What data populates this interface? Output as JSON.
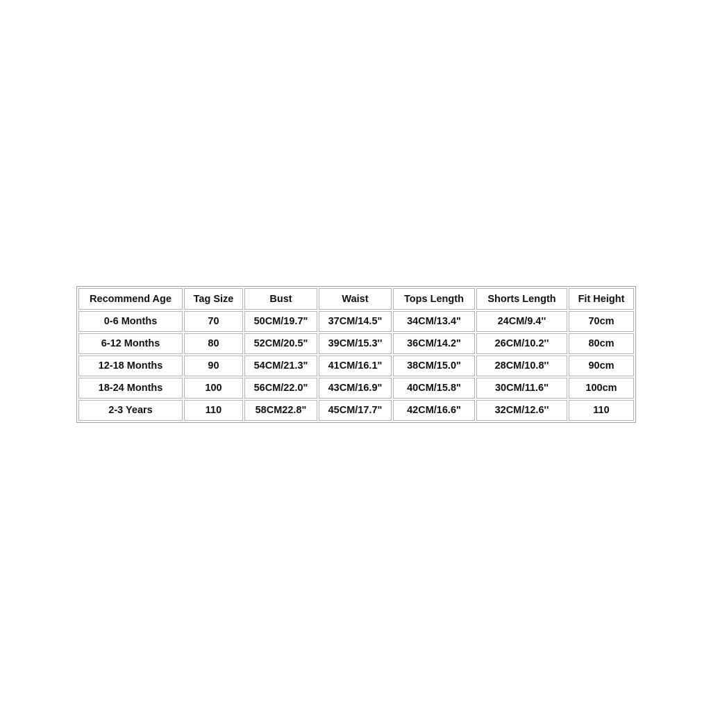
{
  "table": {
    "headers": [
      "Recommend Age",
      "Tag Size",
      "Bust",
      "Waist",
      "Tops Length",
      "Shorts Length",
      "Fit Height"
    ],
    "rows": [
      [
        "0-6 Months",
        "70",
        "50CM/19.7\"",
        "37CM/14.5\"",
        "34CM/13.4\"",
        "24CM/9.4''",
        "70cm"
      ],
      [
        "6-12 Months",
        "80",
        "52CM/20.5\"",
        "39CM/15.3''",
        "36CM/14.2\"",
        "26CM/10.2''",
        "80cm"
      ],
      [
        "12-18 Months",
        "90",
        "54CM/21.3\"",
        "41CM/16.1\"",
        "38CM/15.0\"",
        "28CM/10.8''",
        "90cm"
      ],
      [
        "18-24 Months",
        "100",
        "56CM/22.0\"",
        "43CM/16.9\"",
        "40CM/15.8\"",
        "30CM/11.6''",
        "100cm"
      ],
      [
        "2-3 Years",
        "110",
        "58CM22.8\"",
        "45CM/17.7\"",
        "42CM/16.6\"",
        "32CM/12.6''",
        "110"
      ]
    ]
  }
}
